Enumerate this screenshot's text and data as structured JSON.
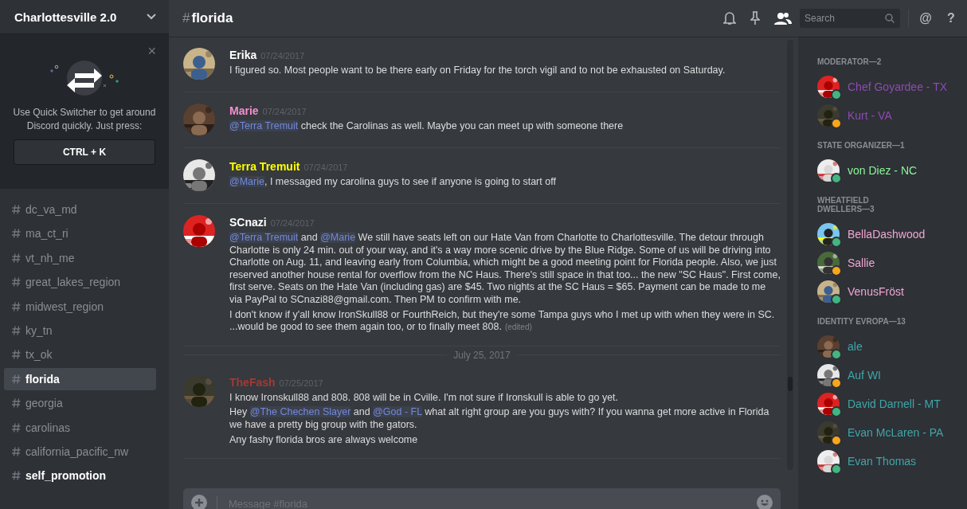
{
  "server": {
    "name": "Charlottesville 2.0"
  },
  "quick_switcher": {
    "close": "×",
    "text": "Use Quick Switcher to get around Discord quickly. Just press:",
    "shortcut": "CTRL + K"
  },
  "channels": [
    {
      "name": "dc_va_md",
      "selected": false,
      "unread": false
    },
    {
      "name": "ma_ct_ri",
      "selected": false,
      "unread": false
    },
    {
      "name": "vt_nh_me",
      "selected": false,
      "unread": false
    },
    {
      "name": "great_lakes_region",
      "selected": false,
      "unread": false
    },
    {
      "name": "midwest_region",
      "selected": false,
      "unread": false
    },
    {
      "name": "ky_tn",
      "selected": false,
      "unread": false
    },
    {
      "name": "tx_ok",
      "selected": false,
      "unread": false
    },
    {
      "name": "florida",
      "selected": true,
      "unread": false
    },
    {
      "name": "georgia",
      "selected": false,
      "unread": false
    },
    {
      "name": "carolinas",
      "selected": false,
      "unread": false
    },
    {
      "name": "california_pacific_nw",
      "selected": false,
      "unread": false
    },
    {
      "name": "self_promotion",
      "selected": false,
      "unread": true
    }
  ],
  "header": {
    "hash": "#",
    "channel": "florida",
    "search_placeholder": "Search",
    "mention_icon": "@",
    "help_icon": "?"
  },
  "messages": [
    {
      "kind": "message",
      "author": "Erika",
      "color": "#ffffff",
      "time": "07/24/2017",
      "lines": [
        [
          {
            "kind": "text",
            "text": "I figured so. Most people want to be there early on Friday for the torch vigil and to not be exhausted on Saturday."
          }
        ]
      ]
    },
    {
      "kind": "message",
      "author": "Marie",
      "color": "#f48fce",
      "time": "07/24/2017",
      "lines": [
        [
          {
            "kind": "mention",
            "text": "@Terra Tremuit"
          },
          {
            "kind": "text",
            "text": " check the Carolinas as well. Maybe you can meet up with someone there"
          }
        ]
      ]
    },
    {
      "kind": "message",
      "author": "Terra Tremuit",
      "color": "#ffff00",
      "time": "07/24/2017",
      "lines": [
        [
          {
            "kind": "mention",
            "text": "@Marie"
          },
          {
            "kind": "text",
            "text": ", I messaged my carolina guys to see if anyone is going to start off"
          }
        ]
      ]
    },
    {
      "kind": "message",
      "author": "SCnazi",
      "color": "#ffffff",
      "time": "07/24/2017",
      "lines": [
        [
          {
            "kind": "mention",
            "text": "@Terra Tremuit"
          },
          {
            "kind": "text",
            "text": " and "
          },
          {
            "kind": "mention",
            "text": "@Marie"
          },
          {
            "kind": "text",
            "text": " We still have seats left on our Hate Van from Charlotte to Charlottesville. The detour through Charlotte is only 24 min. out of your way, and it's a way more scenic drive by the Blue Ridge. Some of us will be driving into Charlotte on Aug. 11, and leaving early from Columbia, which might be a good meeting point for Florida people. Also, we just reserved another house rental for overflow from the NC Haus. There's still space in that too... the new \"SC Haus\". First come, first serve. Seats on the Hate Van (including gas) are $45. Two nights at the SC Haus = $65. Payment can be made to me via PayPal to SCnazi88@gmail.com. Then PM to confirm with me."
          }
        ],
        [
          {
            "kind": "text",
            "text": "I don't know if y'all know IronSkull88 or FourthReich, but they're some Tampa guys who I met up with when they were in SC. ...would be good to see them again too, or to finally meet 808."
          },
          {
            "kind": "edited",
            "text": "(edited)"
          }
        ]
      ]
    },
    {
      "kind": "divider",
      "text": "July 25, 2017"
    },
    {
      "kind": "message",
      "author": "TheFash",
      "color": "#a33a36",
      "time": "07/25/2017",
      "lines": [
        [
          {
            "kind": "text",
            "text": "I know Ironskull88 and 808. 808 will be in Cville. I'm not sure if Ironskull is able to go yet."
          }
        ],
        [
          {
            "kind": "text",
            "text": "Hey "
          },
          {
            "kind": "mention",
            "text": "@The Chechen Slayer"
          },
          {
            "kind": "text",
            "text": " and "
          },
          {
            "kind": "mention",
            "text": "@God - FL"
          },
          {
            "kind": "text",
            "text": " what alt right group are you guys with? If you wanna get more active in Florida we have a pretty big group with the gators."
          }
        ],
        [
          {
            "kind": "text",
            "text": "Any fashy florida bros are always welcome"
          }
        ]
      ]
    }
  ],
  "composer": {
    "placeholder": "Message #florida"
  },
  "member_groups": [
    {
      "title": "MODERATOR—2",
      "members": [
        {
          "name": "Chef Goyardee - TX",
          "color": "#8d4bb0",
          "dot": {
            "color": "#43b581"
          }
        },
        {
          "name": "Kurt - VA",
          "color": "#8d4bb0",
          "dot": {
            "color": "#faa61a"
          }
        }
      ]
    },
    {
      "title": "STATE ORGANIZER—1",
      "members": [
        {
          "name": "von Diez - NC",
          "color": "#8cf59a",
          "dot": {
            "color": "#43b581"
          }
        }
      ]
    },
    {
      "title": "WHEATFIELD DWELLERS—3",
      "members": [
        {
          "name": "BellaDashwood",
          "color": "#f0a6d4",
          "dot": {
            "color": "#43b581"
          }
        },
        {
          "name": "Sallie",
          "color": "#f0a6d4",
          "dot": {
            "color": "#faa61a"
          }
        },
        {
          "name": "VenusFröst",
          "color": "#f0a6d4",
          "dot": {
            "color": "#43b581"
          }
        }
      ]
    },
    {
      "title": "IDENTITY EVROPA—13",
      "members": [
        {
          "name": "ale",
          "color": "#3fa6a8",
          "dot": {
            "color": "#43b581"
          }
        },
        {
          "name": "Auf WI",
          "color": "#3fa6a8",
          "dot": {
            "color": "#faa61a"
          }
        },
        {
          "name": "David Darnell - MT",
          "color": "#3fa6a8",
          "dot": {
            "color": "#43b581"
          }
        },
        {
          "name": "Evan McLaren - PA",
          "color": "#3fa6a8",
          "dot": {
            "color": "#faa61a"
          }
        },
        {
          "name": "Evan Thomas",
          "color": "#3fa6a8",
          "dot": {
            "color": "#43b581"
          }
        }
      ]
    }
  ]
}
